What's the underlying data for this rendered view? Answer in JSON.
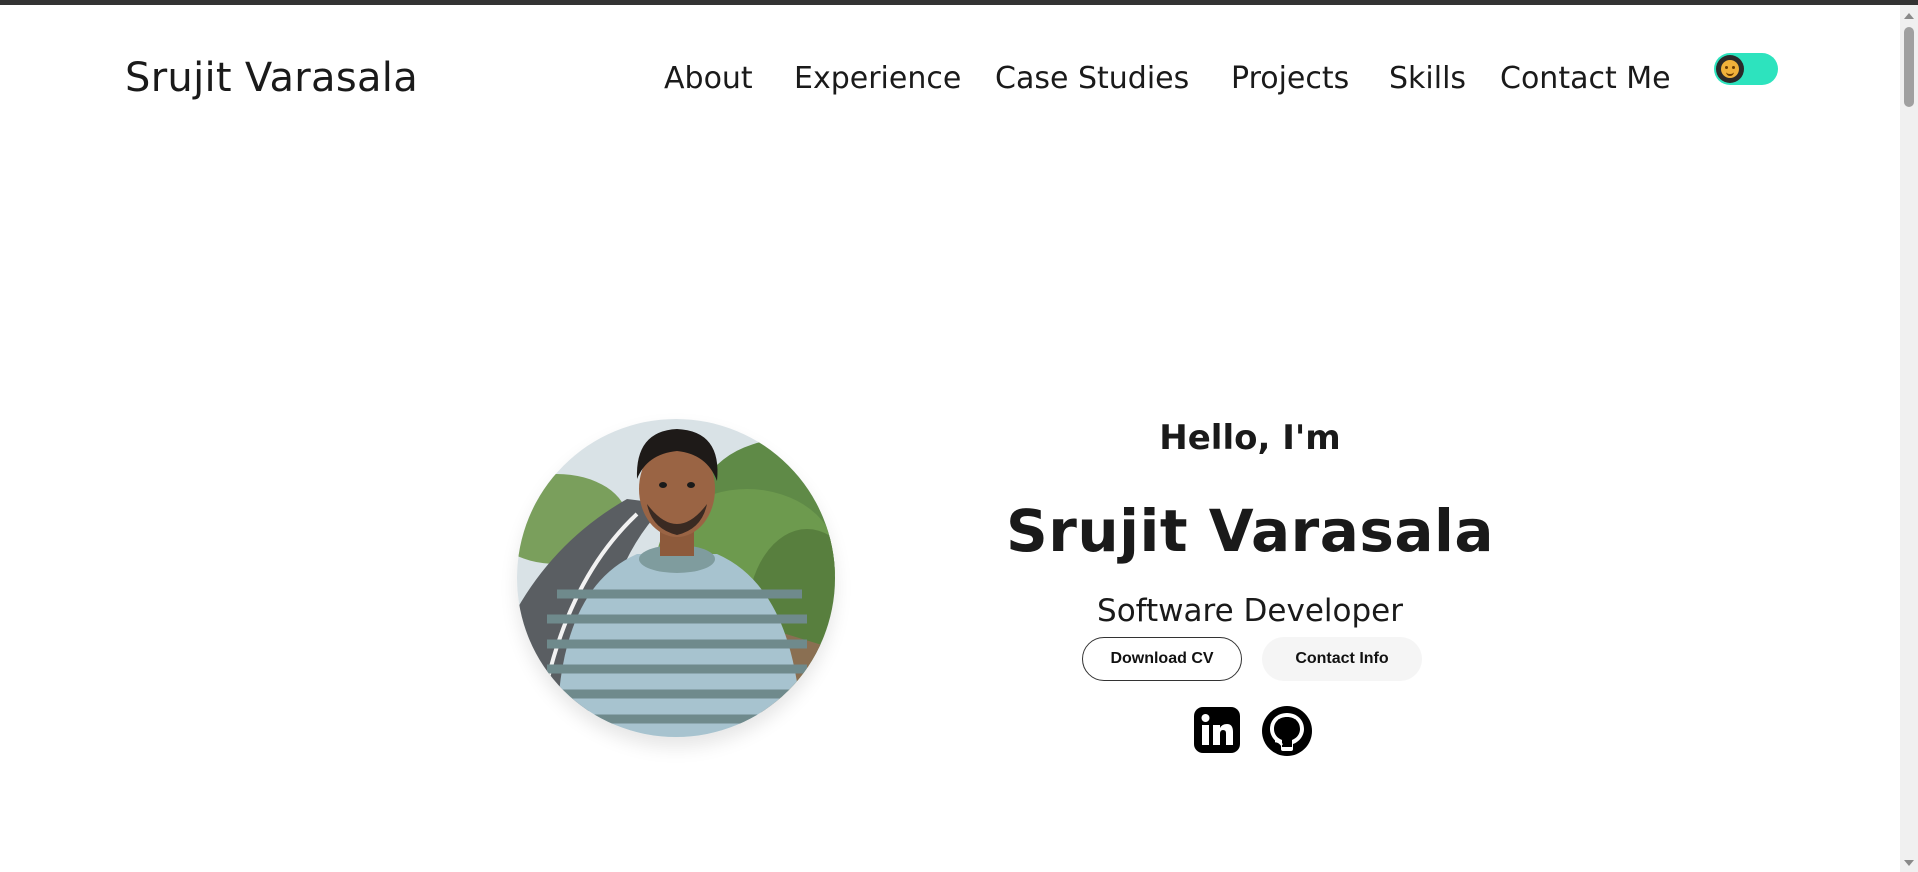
{
  "header": {
    "logo": "Srujit Varasala",
    "nav": [
      {
        "label": "About"
      },
      {
        "label": "Experience"
      },
      {
        "label": "Case Studies"
      },
      {
        "label": "Projects"
      },
      {
        "label": "Skills"
      },
      {
        "label": "Contact Me"
      }
    ],
    "theme_toggle": {
      "icon": "sun-face-icon",
      "track_color": "#2de3be"
    }
  },
  "hero": {
    "greeting": "Hello, I'm",
    "name": "Srujit Varasala",
    "role": "Software Developer",
    "buttons": {
      "download_cv": "Download CV",
      "contact_info": "Contact Info"
    },
    "social": [
      {
        "icon": "linkedin-icon"
      },
      {
        "icon": "github-icon"
      }
    ]
  }
}
